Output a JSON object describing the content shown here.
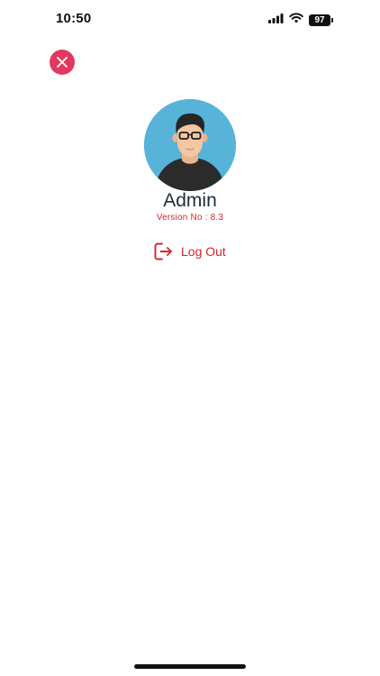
{
  "status_bar": {
    "time": "10:50",
    "battery": "97"
  },
  "close_button": {
    "icon": "close-icon",
    "color": "#e2385f"
  },
  "profile": {
    "avatar_icon": "user-avatar-icon",
    "name": "Admin",
    "version": "Version No : 8.3"
  },
  "logout": {
    "icon": "logout-icon",
    "label": "Log Out",
    "color": "#d8262a"
  }
}
